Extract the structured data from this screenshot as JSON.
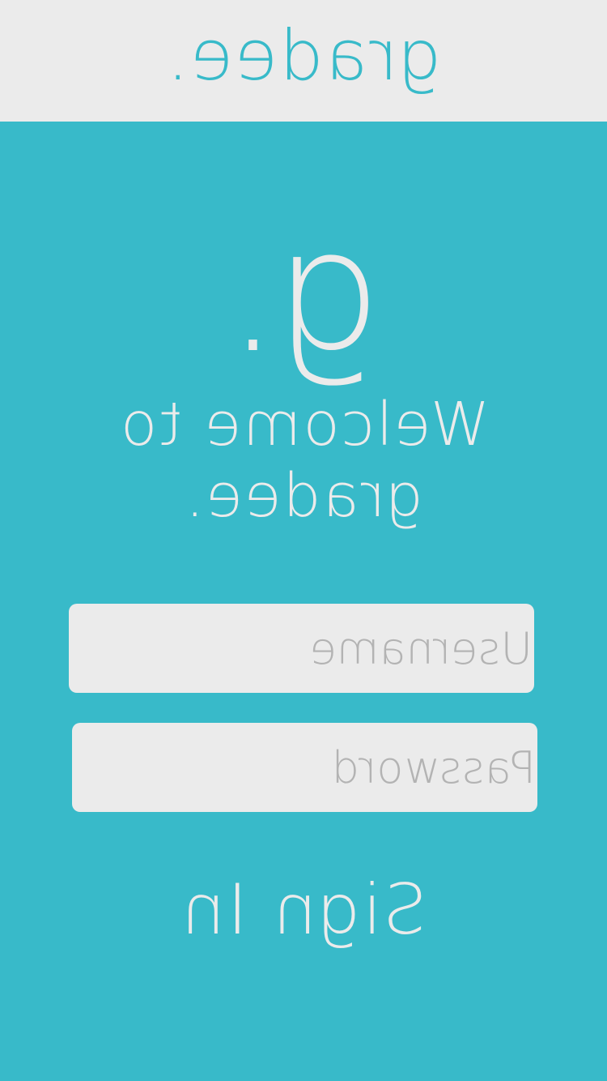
{
  "header": {
    "brand": "gradee."
  },
  "main": {
    "logo_mark": "g.",
    "welcome_line1": "Welcome to",
    "welcome_line2": "gradee.",
    "username_placeholder": "Username",
    "password_placeholder": "Password",
    "signin_label": "Sign In"
  },
  "colors": {
    "accent": "#38bac9",
    "light": "#ebebeb",
    "placeholder": "#b3b3b3"
  }
}
